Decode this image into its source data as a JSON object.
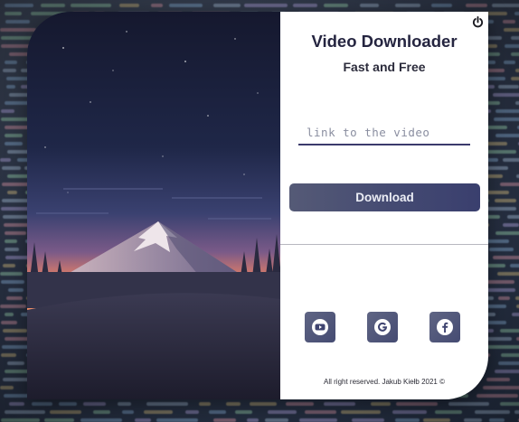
{
  "header": {
    "title": "Video Downloader",
    "subtitle": "Fast and Free"
  },
  "form": {
    "link_placeholder": "link to the video",
    "link_value": "",
    "download_label": "Download"
  },
  "socials": [
    {
      "name": "youtube",
      "icon": "youtube-icon"
    },
    {
      "name": "google",
      "icon": "google-icon"
    },
    {
      "name": "facebook",
      "icon": "facebook-icon"
    }
  ],
  "footer": {
    "copyright": "All right reserved. Jakub Kiełb 2021 ©"
  },
  "icons": {
    "power": "power-icon"
  },
  "colors": {
    "accent": "#3b3a6c",
    "button": "#444a72",
    "text_dark": "#252540",
    "panel_bg": "#ffffff"
  }
}
